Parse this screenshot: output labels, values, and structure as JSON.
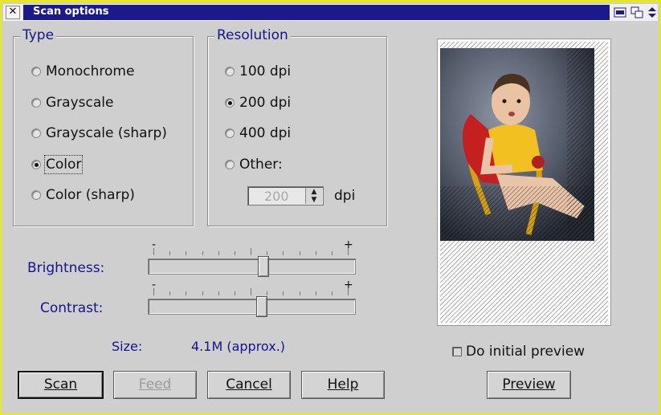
{
  "window": {
    "title": "Scan options",
    "close_glyph": "✕",
    "titlebar_icons": [
      "minimize-icon",
      "restore-icon",
      "scroll-arrows-icon"
    ]
  },
  "type_group": {
    "title": "Type",
    "options": [
      {
        "label": "Monochrome",
        "checked": false
      },
      {
        "label": "Grayscale",
        "checked": false
      },
      {
        "label": "Grayscale (sharp)",
        "checked": false
      },
      {
        "label": "Color",
        "checked": true
      },
      {
        "label": "Color (sharp)",
        "checked": false
      }
    ]
  },
  "resolution_group": {
    "title": "Resolution",
    "options": [
      {
        "label": "100 dpi",
        "checked": false
      },
      {
        "label": "200 dpi",
        "checked": true
      },
      {
        "label": "400 dpi",
        "checked": false
      },
      {
        "label": "Other:",
        "checked": false
      }
    ],
    "other_value": "200",
    "other_unit": "dpi"
  },
  "brightness": {
    "label": "Brightness:",
    "minus": "-",
    "plus": "+",
    "level": 0.56
  },
  "contrast": {
    "label": "Contrast:",
    "minus": "-",
    "plus": "+",
    "level": 0.55
  },
  "size": {
    "label": "Size:",
    "value": "4.1M (approx.)"
  },
  "buttons": {
    "scan": "Scan",
    "feed": "Feed",
    "cancel": "Cancel",
    "help": "Help",
    "preview": "Preview"
  },
  "initial_preview": {
    "label": "Do initial preview",
    "checked": false
  },
  "colors": {
    "title_bar": "#1a1a8c",
    "label_blue": "#14148c",
    "window_border": "#e8e81a",
    "background": "#cfcfcf"
  }
}
